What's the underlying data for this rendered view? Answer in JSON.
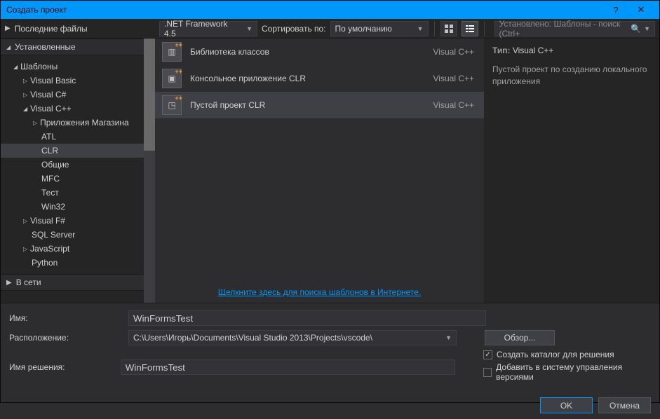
{
  "window": {
    "title": "Создать проект"
  },
  "toolbar": {
    "recent_label": "Последние файлы",
    "framework": ".NET Framework 4.5",
    "sort_label": "Сортировать по:",
    "sort_value": "По умолчанию",
    "search_placeholder": "Установлено: Шаблоны - поиск (Ctrl+"
  },
  "sidebar": {
    "installed": "Установленные",
    "templates": "Шаблоны",
    "vb": "Visual Basic",
    "cs": "Visual C#",
    "cpp": "Visual C++",
    "store": "Приложения Магазина",
    "atl": "ATL",
    "clr": "CLR",
    "general": "Общие",
    "mfc": "MFC",
    "test": "Тест",
    "win32": "Win32",
    "fs": "Visual F#",
    "sql": "SQL Server",
    "js": "JavaScript",
    "python": "Python",
    "online": "В сети"
  },
  "templates": [
    {
      "name": "Библиотека классов",
      "lang": "Visual C++"
    },
    {
      "name": "Консольное приложение CLR",
      "lang": "Visual C++"
    },
    {
      "name": "Пустой проект CLR",
      "lang": "Visual C++"
    }
  ],
  "details": {
    "type_label": "Тип:",
    "type_value": "Visual C++",
    "description": "Пустой проект по созданию локального приложения"
  },
  "online_link": "Щелкните здесь для поиска шаблонов в Интернете.",
  "form": {
    "name_label": "Имя:",
    "name_value": "WinFormsTest",
    "location_label": "Расположение:",
    "location_value": "C:\\Users\\Игорь\\Documents\\Visual Studio 2013\\Projects\\vscode\\",
    "solution_label": "Имя решения:",
    "solution_value": "WinFormsTest",
    "browse": "Обзор...",
    "create_dir": "Создать каталог для решения",
    "add_scm": "Добавить в систему управления версиями"
  },
  "buttons": {
    "ok": "OK",
    "cancel": "Отмена"
  }
}
